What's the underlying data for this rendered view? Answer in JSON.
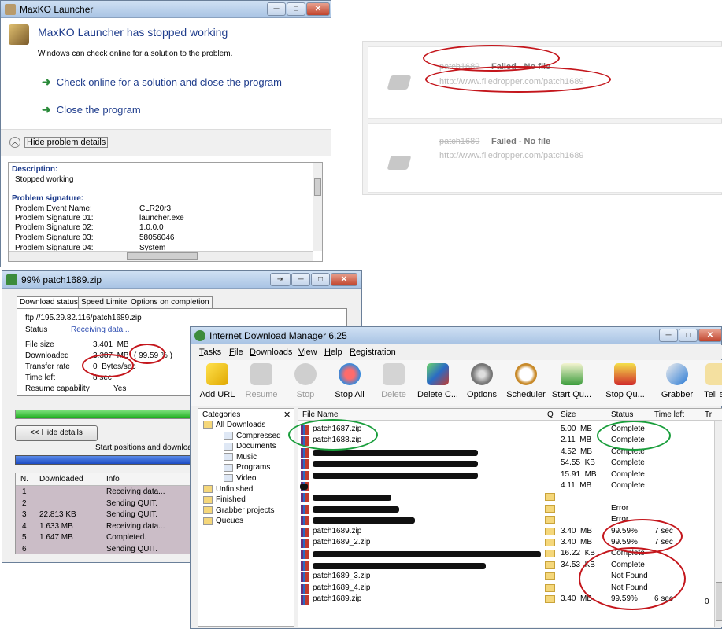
{
  "maxko": {
    "title": "MaxKO Launcher",
    "heading": "MaxKO Launcher has stopped working",
    "subtext": "Windows can check online for a solution to the problem.",
    "option_check": "Check online for a solution and close the program",
    "option_close": "Close the program",
    "details_toggle": "Hide problem details",
    "description_label": "Description:",
    "description_value": "Stopped working",
    "signature_label": "Problem signature:",
    "signature_rows": [
      {
        "name": "Problem Event Name:",
        "value": "CLR20r3"
      },
      {
        "name": "Problem Signature 01:",
        "value": "launcher.exe"
      },
      {
        "name": "Problem Signature 02:",
        "value": "1.0.0.0"
      },
      {
        "name": "Problem Signature 03:",
        "value": "58056046"
      },
      {
        "name": "Problem Signature 04:",
        "value": "System"
      }
    ]
  },
  "filedropper": {
    "items": [
      {
        "name": "patch1689",
        "status": "Failed - No file",
        "url": "http://www.filedropper.com/patch1689"
      },
      {
        "name": "patch1689",
        "status": "Failed - No file",
        "url": "http://www.filedropper.com/patch1689"
      }
    ]
  },
  "progress": {
    "title": "99% patch1689.zip",
    "tabs": [
      "Download status",
      "Speed Limiter",
      "Options on completion"
    ],
    "url": "ftp://195.29.82.116/patch1689.zip",
    "status_label": "Status",
    "status_value": "Receiving data...",
    "fields": [
      {
        "label": "File size",
        "value": "3.401  MB"
      },
      {
        "label": "Downloaded",
        "value": "3.387  MB"
      },
      {
        "label": "Transfer rate",
        "value": "0  Bytes/sec"
      },
      {
        "label": "Time left",
        "value": "8 sec"
      },
      {
        "label": "Resume capability",
        "value": "Yes"
      }
    ],
    "downloaded_pct": "( 99.59 % )",
    "progress_fraction": 0.9959,
    "hide_details": "<< Hide details",
    "start_positions_text": "Start positions and download",
    "conn_headers": [
      "N.",
      "Downloaded",
      "Info"
    ],
    "conn_rows": [
      {
        "n": "1",
        "downloaded": "",
        "info": "Receiving data..."
      },
      {
        "n": "2",
        "downloaded": "",
        "info": "Sending QUIT."
      },
      {
        "n": "3",
        "downloaded": "22.813  KB",
        "info": "Sending QUIT."
      },
      {
        "n": "4",
        "downloaded": "1.633  MB",
        "info": "Receiving data..."
      },
      {
        "n": "5",
        "downloaded": "1.647  MB",
        "info": "Completed."
      },
      {
        "n": "6",
        "downloaded": "",
        "info": "Sending QUIT."
      }
    ]
  },
  "idm": {
    "title": "Internet Download Manager 6.25",
    "menu": [
      "Tasks",
      "File",
      "Downloads",
      "View",
      "Help",
      "Registration"
    ],
    "toolbar": [
      "Add URL",
      "Resume",
      "Stop",
      "Stop All",
      "Delete",
      "Delete C...",
      "Options",
      "Scheduler",
      "Start Qu...",
      "Stop Qu...",
      "Grabber",
      "Tell a f"
    ],
    "categories_header": "Categories",
    "categories": [
      {
        "label": "All Downloads",
        "level": 0
      },
      {
        "label": "Compressed",
        "level": 1
      },
      {
        "label": "Documents",
        "level": 1
      },
      {
        "label": "Music",
        "level": 1
      },
      {
        "label": "Programs",
        "level": 1
      },
      {
        "label": "Video",
        "level": 1
      },
      {
        "label": "Unfinished",
        "level": 0
      },
      {
        "label": "Finished",
        "level": 0
      },
      {
        "label": "Grabber projects",
        "level": 0
      },
      {
        "label": "Queues",
        "level": 0
      }
    ],
    "columns": [
      "File Name",
      "Q",
      "Size",
      "Status",
      "Time left",
      "Tr"
    ],
    "rows": [
      {
        "name": "patch1687.zip",
        "size": "5.00  MB",
        "status": "Complete",
        "time": ""
      },
      {
        "name": "patch1688.zip",
        "size": "2.11  MB",
        "status": "Complete",
        "time": ""
      },
      {
        "name": "",
        "size": "4.52  MB",
        "status": "Complete",
        "time": ""
      },
      {
        "name": "",
        "size": "54.55  KB",
        "status": "Complete",
        "time": ""
      },
      {
        "name": "",
        "size": "15.91  MB",
        "status": "Complete",
        "time": ""
      },
      {
        "name": "",
        "size": "4.11  MB",
        "status": "Complete",
        "time": ""
      },
      {
        "name": "",
        "size": "",
        "status": "",
        "time": ""
      },
      {
        "name": "",
        "size": "",
        "status": "Error",
        "time": ""
      },
      {
        "name": "",
        "size": "",
        "status": "Error",
        "time": ""
      },
      {
        "name": "patch1689.zip",
        "size": "3.40  MB",
        "status": "99.59%",
        "time": "7 sec"
      },
      {
        "name": "patch1689_2.zip",
        "size": "3.40  MB",
        "status": "99.59%",
        "time": "7 sec"
      },
      {
        "name": "",
        "size": "16.22  KB",
        "status": "Complete",
        "time": ""
      },
      {
        "name": "",
        "size": "34.53  KB",
        "status": "Complete",
        "time": ""
      },
      {
        "name": "patch1689_3.zip",
        "size": "",
        "status": "Not Found",
        "time": ""
      },
      {
        "name": "patch1689_4.zip",
        "size": "",
        "status": "Not Found",
        "time": ""
      },
      {
        "name": "patch1689.zip",
        "size": "3.40  MB",
        "status": "99.59%",
        "time": "6 sec"
      }
    ],
    "last_tr": "0"
  }
}
